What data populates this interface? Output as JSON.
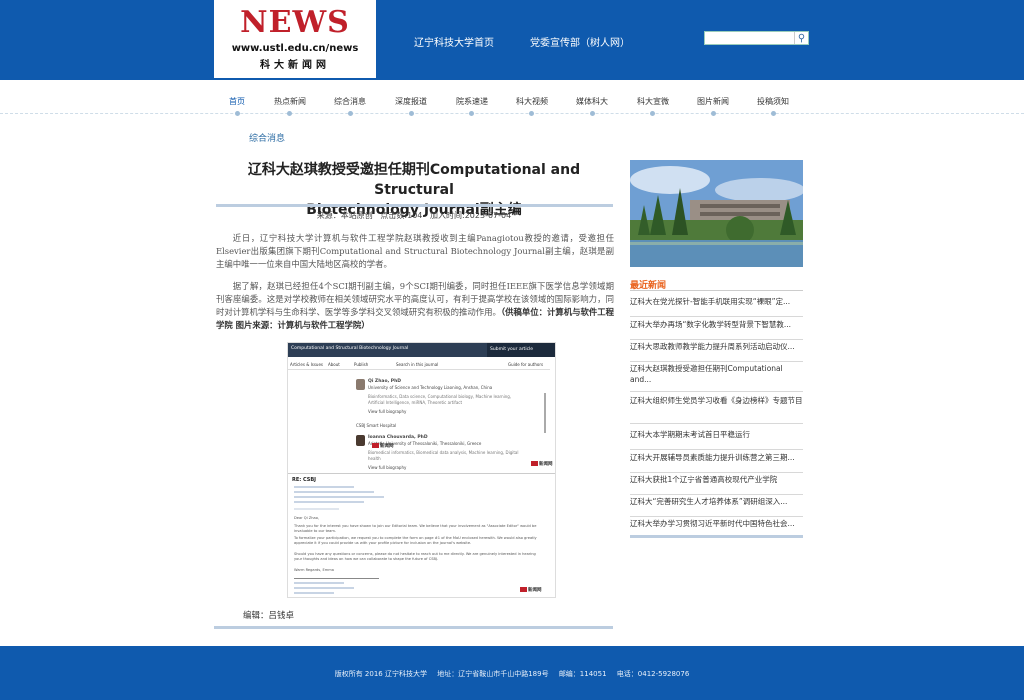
{
  "header": {
    "logo_news": "NEWS",
    "logo_url": "www.ustl.edu.cn/news",
    "logo_name": "科大新闻网",
    "links": [
      "辽宁科技大学首页",
      "党委宣传部（树人网）"
    ],
    "search_placeholder": ""
  },
  "nav": {
    "items": [
      "首页",
      "热点新闻",
      "综合消息",
      "深度报道",
      "院系速递",
      "科大视频",
      "媒体科大",
      "科大宣微",
      "图片新闻",
      "投稿须知"
    ]
  },
  "breadcrumb": "综合消息",
  "article": {
    "title_line1": "辽科大赵琪教授受邀担任期刊Computational and Structural",
    "title_line2": "Biotechnology Journal副主编",
    "meta": "来源：本站原创   点击数:104   加入时间:2023-07-04",
    "para1": "近日，辽宁科技大学计算机与软件工程学院赵琪教授收到主编Panagiotou教授的邀请，受邀担任Elsevier出版集团旗下期刊Computational and Structural Biotechnology Journal副主编，赵琪是副主编中唯一一位来自中国大陆地区高校的学者。",
    "para2": "据了解，赵琪已经担任4个SCI期刊副主编，9个SCI期刊编委，同时担任IEEE旗下医学信息学领域期刊客座编委。这是对学校教师在相关领域研究水平的高度认可，有利于提高学校在该领域的国际影响力，同时对计算机学科与生命科学、医学等多学科交叉领域研究有积极的推动作用。",
    "para2_source": "（供稿单位：计算机与软件工程学院  图片来源：计算机与软件工程学院）",
    "byline": "编辑：吕钱卓"
  },
  "screenshot": {
    "journal": "Computational and Structural Biotechnology Journal",
    "submit": "Submit your article",
    "nav": [
      "Articles & Issues",
      "About",
      "Publish",
      "Search in this journal",
      "Guide for authors"
    ],
    "person1": "Qi Zhao, PhD",
    "person1_aff": "University of Science and Technology Liaoning, Anshan, China",
    "person1_detail": "Bioinformatics, Data science, Computational biology, Machine learning, Artificial Intelligence, miRNA, Theoretic artifact",
    "bio_link": "View full biography",
    "section": "CSBJ Smart Hospital",
    "person2": "Ioanna Chouvarda, PhD",
    "person2_aff": "Aristotle University of Thessaloniki, Thessaloniki, Greece",
    "person2_detail": "Biomedical informatics, Biomedical data analysis, Machine learning, Digital health",
    "watermark": "新闻网",
    "email_subject": "RE: CSBJ",
    "email_greeting": "Dear Qi Zhao,",
    "email_body1": "Thank you for the interest you have shown to join our Editorial team. We believe that your involvement as \"Associate Editor\" would be invaluable to our team.",
    "email_body2": "To formalize your participation, we request you to complete the form on page #1 of the MoU enclosed herewith. We would also greatly appreciate it if you could provide us with your profile picture for inclusion on the journal's website.",
    "email_body3": "Should you have any questions or concerns, please do not hesitate to reach out to me directly. We are genuinely interested in hearing your thoughts and ideas on how we can collaborate to shape the future of CSBJ.",
    "email_sign": "Warm Regards, Emma"
  },
  "sidebar": {
    "heading": "最近新闻",
    "news": [
      "辽科大在党光探针-智能手机联用实现“裸眼”定...",
      "辽科大举办再场“数字化教学转型背景下智慧教...",
      "辽科大思政教师教学能力提升周系列活动启动仪...",
      "辽科大赵琪教授受邀担任期刊Computational and...",
      "辽科大组织师生党员学习收看《身边榜样》专题节目",
      "辽科大本学期期末考试首日平稳运行",
      "辽科大开展辅导员素质能力提升训练营之第三期...",
      "辽科大获批1个辽宁省普通高校现代产业学院",
      "辽科大“完善研究生人才培养体系”调研组深入...",
      "辽科大举办学习贯彻习近平新时代中国特色社会..."
    ]
  },
  "footer": {
    "copyright": "版权所有 2016 辽宁科技大学",
    "address": "地址：辽宁省鞍山市千山中路189号",
    "postcode": "邮编：114051",
    "phone": "电话：0412-5928076"
  }
}
